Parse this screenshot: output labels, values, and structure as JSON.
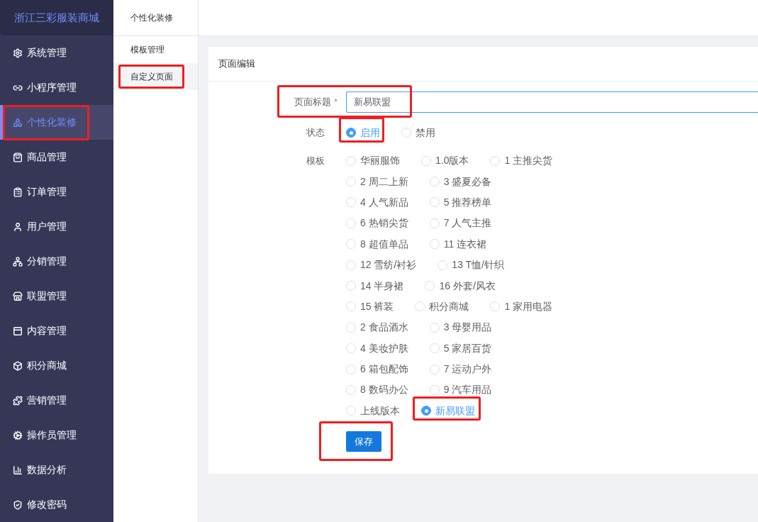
{
  "sidebar": {
    "brand": "浙江三彩服装商城",
    "items": [
      {
        "kind": "gear",
        "label": "系统管理",
        "selected": false,
        "highlighted": false
      },
      {
        "kind": "link",
        "label": "小程序管理",
        "selected": false,
        "highlighted": false
      },
      {
        "kind": "shapes",
        "label": "个性化装修",
        "selected": true,
        "highlighted": true
      },
      {
        "kind": "bag",
        "label": "商品管理",
        "selected": false,
        "highlighted": false
      },
      {
        "kind": "clipboard",
        "label": "订单管理",
        "selected": false,
        "highlighted": false
      },
      {
        "kind": "user",
        "label": "用户管理",
        "selected": false,
        "highlighted": false
      },
      {
        "kind": "network",
        "label": "分销管理",
        "selected": false,
        "highlighted": false
      },
      {
        "kind": "store",
        "label": "联盟管理",
        "selected": false,
        "highlighted": false
      },
      {
        "kind": "panel",
        "label": "内容管理",
        "selected": false,
        "highlighted": false
      },
      {
        "kind": "box",
        "label": "积分商城",
        "selected": false,
        "highlighted": false
      },
      {
        "kind": "puzzle",
        "label": "营销管理",
        "selected": false,
        "highlighted": false
      },
      {
        "kind": "cog",
        "label": "操作员管理",
        "selected": false,
        "highlighted": false
      },
      {
        "kind": "chart",
        "label": "数据分析",
        "selected": false,
        "highlighted": false
      },
      {
        "kind": "shield",
        "label": "修改密码",
        "selected": false,
        "highlighted": false
      }
    ]
  },
  "submenu": {
    "title": "个性化装修",
    "items": [
      {
        "label": "模板管理",
        "selected": false,
        "highlighted": false
      },
      {
        "label": "自定义页面",
        "selected": true,
        "highlighted": true
      }
    ]
  },
  "card": {
    "title": "页面编辑",
    "page_title": {
      "label": "页面标题",
      "required_mark": "*",
      "value": "新易联盟",
      "highlighted": true
    },
    "status": {
      "label": "状态",
      "options": [
        {
          "label": "启用",
          "selected": true,
          "highlighted": true
        },
        {
          "label": "禁用",
          "selected": false,
          "highlighted": false
        }
      ]
    },
    "template": {
      "label": "模板",
      "options": [
        {
          "label": "华丽服饰",
          "selected": false,
          "highlighted": false
        },
        {
          "label": "1.0版本",
          "selected": false,
          "highlighted": false
        },
        {
          "label": "1 主推尖货",
          "selected": false,
          "highlighted": false
        },
        {
          "label": "2 周二上新",
          "selected": false,
          "highlighted": false
        },
        {
          "label": "3 盛夏必备",
          "selected": false,
          "highlighted": false
        },
        {
          "label": "4 人气新品",
          "selected": false,
          "highlighted": false
        },
        {
          "label": "5 推荐榜单",
          "selected": false,
          "highlighted": false
        },
        {
          "label": "6 热销尖货",
          "selected": false,
          "highlighted": false
        },
        {
          "label": "7 人气主推",
          "selected": false,
          "highlighted": false
        },
        {
          "label": "8 超值单品",
          "selected": false,
          "highlighted": false
        },
        {
          "label": "11 连衣裙",
          "selected": false,
          "highlighted": false
        },
        {
          "label": "12 雪纺/衬衫",
          "selected": false,
          "highlighted": false
        },
        {
          "label": "13 T恤/针织",
          "selected": false,
          "highlighted": false
        },
        {
          "label": "14 半身裙",
          "selected": false,
          "highlighted": false
        },
        {
          "label": "16 外套/风衣",
          "selected": false,
          "highlighted": false
        },
        {
          "label": "15 裤装",
          "selected": false,
          "highlighted": false
        },
        {
          "label": "积分商城",
          "selected": false,
          "highlighted": false
        },
        {
          "label": "1 家用电器",
          "selected": false,
          "highlighted": false
        },
        {
          "label": "2 食品酒水",
          "selected": false,
          "highlighted": false
        },
        {
          "label": "3 母婴用品",
          "selected": false,
          "highlighted": false
        },
        {
          "label": "4 美妆护肤",
          "selected": false,
          "highlighted": false
        },
        {
          "label": "5 家居百货",
          "selected": false,
          "highlighted": false
        },
        {
          "label": "6 箱包配饰",
          "selected": false,
          "highlighted": false
        },
        {
          "label": "7 运动户外",
          "selected": false,
          "highlighted": false
        },
        {
          "label": "8 数码办公",
          "selected": false,
          "highlighted": false
        },
        {
          "label": "9 汽车用品",
          "selected": false,
          "highlighted": false
        },
        {
          "label": "上线版本",
          "selected": false,
          "highlighted": false
        },
        {
          "label": "新易联盟",
          "selected": true,
          "highlighted": true
        }
      ]
    },
    "save": {
      "label": "保存",
      "highlighted": true
    }
  }
}
